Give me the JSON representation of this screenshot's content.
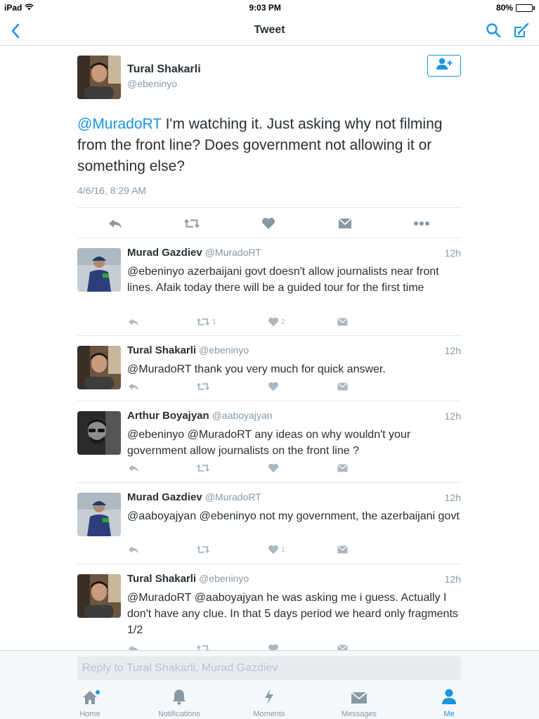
{
  "status_bar": {
    "device": "iPad",
    "time": "9:03 PM",
    "battery": "80%",
    "battery_level": 0.8
  },
  "nav": {
    "title": "Tweet",
    "back_icon": "chevron-left-icon",
    "search_icon": "search-icon",
    "compose_icon": "compose-icon"
  },
  "tweet": {
    "name": "Tural Shakarli",
    "handle": "@ebeninyo",
    "mention": "@MuradoRT",
    "text": " I'm watching it. Just asking why not filming from the front line? Does government not allowing it or something else?",
    "timestamp": "4/6/16, 8:29 AM",
    "follow_icon": "add-user-icon"
  },
  "replies": [
    {
      "name": "Murad Gazdiev",
      "handle": "@MuradoRT",
      "time": "12h",
      "text": "@ebeninyo azerbaijani govt doesn't allow journalists near front lines. Afaik today there will be a guided tour for the first time",
      "retweets": "1",
      "likes": "2"
    },
    {
      "name": "Tural Shakarli",
      "handle": "@ebeninyo",
      "time": "12h",
      "text": "@MuradoRT thank you very much for quick answer.",
      "retweets": "",
      "likes": ""
    },
    {
      "name": "Arthur Boyajyan",
      "handle": "@aaboyajyan",
      "time": "12h",
      "text": "@ebeninyo @MuradoRT any ideas on why wouldn't your government allow journalists on the front line ?",
      "retweets": "",
      "likes": ""
    },
    {
      "name": "Murad Gazdiev",
      "handle": "@MuradoRT",
      "time": "12h",
      "text": "@aaboyajyan @ebeninyo not my government, the azerbaijani govt",
      "retweets": "",
      "likes": "1"
    },
    {
      "name": "Tural Shakarli",
      "handle": "@ebeninyo",
      "time": "12h",
      "text": "@MuradoRT @aaboyajyan he was asking me i guess. Actually I don't have any clue. In that 5 days period we heard only fragments 1/2",
      "retweets": "",
      "likes": ""
    }
  ],
  "reply_box": {
    "placeholder": "Reply to Tural Shakarli, Murad Gazdiev"
  },
  "tabs": [
    {
      "label": "Home",
      "icon": "home-icon"
    },
    {
      "label": "Notifications",
      "icon": "bell-icon"
    },
    {
      "label": "Moments",
      "icon": "lightning-icon"
    },
    {
      "label": "Messages",
      "icon": "envelope-icon"
    },
    {
      "label": "Me",
      "icon": "person-icon"
    }
  ],
  "colors": {
    "accent": "#1b95e0",
    "muted": "#8899a6",
    "icon_gray": "#aab8c2"
  }
}
